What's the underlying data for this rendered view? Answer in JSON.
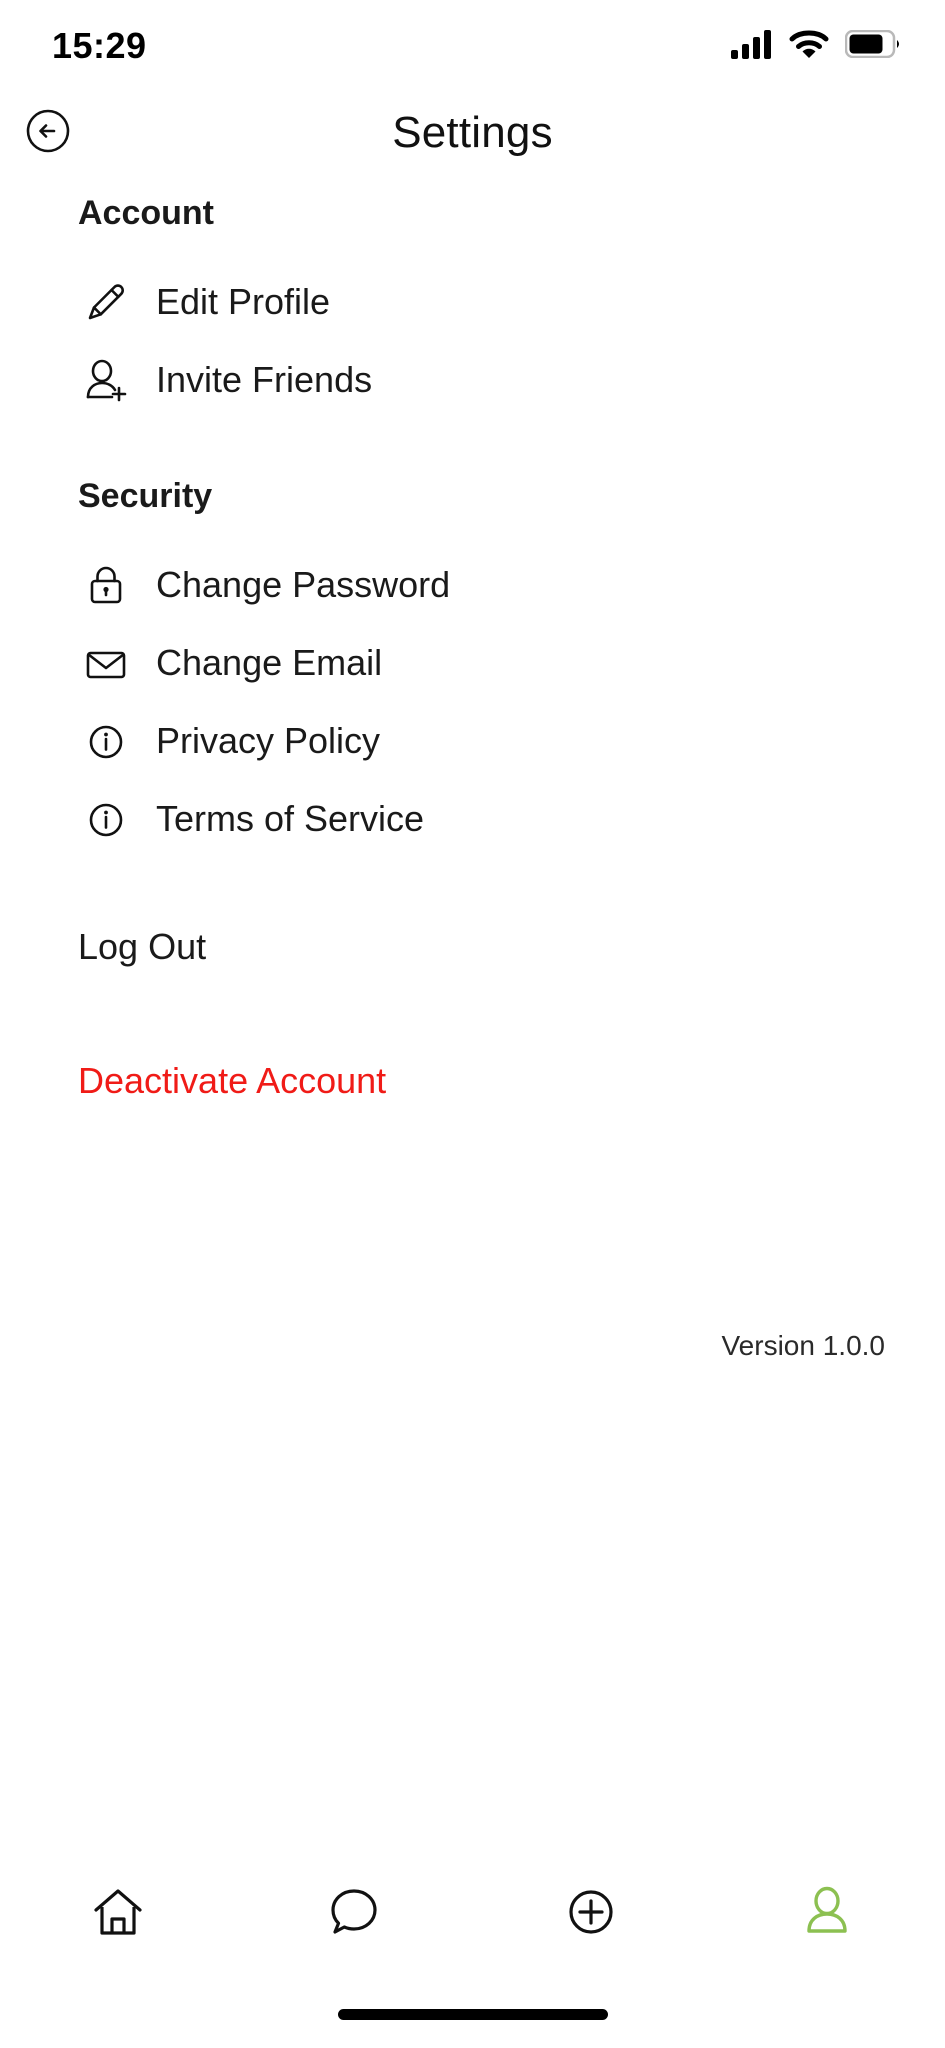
{
  "statusbar": {
    "time": "15:29",
    "cellular_icon": "cellular-signal-icon",
    "cellular_bars_total": 4,
    "cellular_bars_filled": 4,
    "wifi_icon": "wifi-icon",
    "battery_icon": "battery-icon",
    "battery_level_percent": 70
  },
  "header": {
    "back_icon": "back-arrow-circle-icon",
    "title": "Settings"
  },
  "sections": [
    {
      "title": "Account",
      "items": [
        {
          "icon": "pencil-icon",
          "label": "Edit Profile"
        },
        {
          "icon": "person-add-icon",
          "label": "Invite Friends"
        }
      ]
    },
    {
      "title": "Security",
      "items": [
        {
          "icon": "lock-icon",
          "label": "Change Password"
        },
        {
          "icon": "envelope-icon",
          "label": "Change Email"
        },
        {
          "icon": "info-circle-icon",
          "label": "Privacy Policy"
        },
        {
          "icon": "info-circle-icon",
          "label": "Terms of Service"
        }
      ]
    }
  ],
  "actions": {
    "log_out": "Log Out",
    "deactivate": "Deactivate Account"
  },
  "version": "Version 1.0.0",
  "tabbar": {
    "items": [
      {
        "icon": "home-icon",
        "active": false
      },
      {
        "icon": "chat-bubble-icon",
        "active": false
      },
      {
        "icon": "plus-circle-icon",
        "active": false
      },
      {
        "icon": "profile-person-icon",
        "active": true
      }
    ]
  },
  "colors": {
    "text": "#1a1a1a",
    "danger": "#f01b17",
    "tab_active": "#8cc051",
    "tab_inactive": "#111111",
    "background": "#ffffff"
  }
}
